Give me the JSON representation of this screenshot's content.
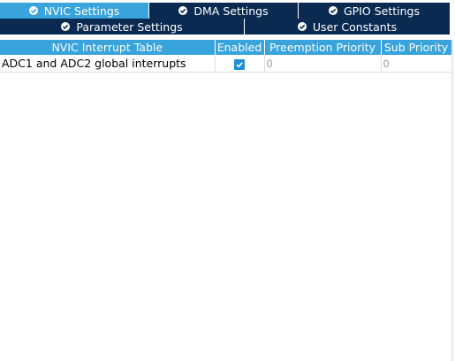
{
  "tabs_row1": [
    {
      "label": "NVIC Settings",
      "active": true
    },
    {
      "label": "DMA Settings",
      "active": false
    },
    {
      "label": "GPIO Settings",
      "active": false
    }
  ],
  "tabs_row2": [
    {
      "label": "Parameter Settings",
      "active": false
    },
    {
      "label": "User Constants",
      "active": false
    }
  ],
  "table": {
    "headers": [
      "NVIC Interrupt Table",
      "Enabled",
      "Preemption Priority",
      "Sub Priority"
    ],
    "rows": [
      {
        "name": "ADC1 and ADC2 global interrupts",
        "enabled": true,
        "preemption": "0",
        "sub": "0"
      }
    ]
  },
  "colors": {
    "tab_bg": "#0b2a52",
    "tab_active": "#39a3dc",
    "header_bg": "#39a3dc",
    "checkbox": "#1e8fd6"
  }
}
